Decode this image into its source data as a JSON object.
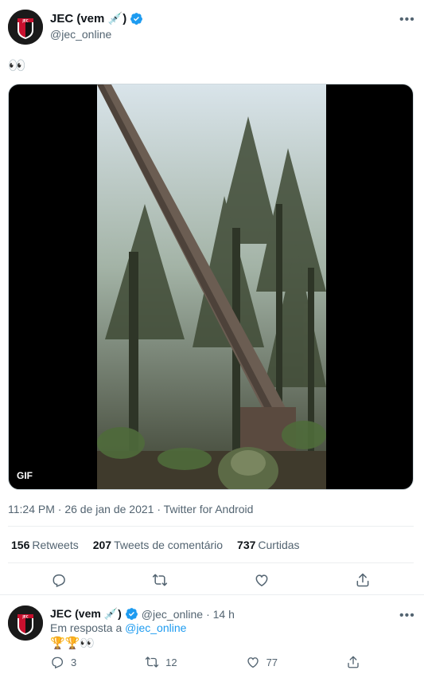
{
  "tweet": {
    "display_name": "JEC (vem 💉)",
    "handle": "@jec_online",
    "text": "👀",
    "media_badge": "GIF",
    "timestamp": "11:24 PM · 26 de jan de 2021 · Twitter for Android",
    "stats": {
      "retweets_count": "156",
      "retweets_label": "Retweets",
      "comments_count": "207",
      "comments_label": "Tweets de comentário",
      "likes_count": "737",
      "likes_label": "Curtidas"
    },
    "more_icon": "more-icon",
    "action_icons": [
      "reply-icon",
      "retweet-icon",
      "like-icon",
      "share-icon"
    ]
  },
  "reply": {
    "display_name": "JEC (vem 💉)",
    "handle": "@jec_online",
    "time": "· 14 h",
    "reply_prefix": "Em resposta a ",
    "reply_to": "@jec_online",
    "text": "🏆🏆👀",
    "counts": {
      "replies": "3",
      "retweets": "12",
      "likes": "77"
    }
  },
  "colors": {
    "text": "#0f1419",
    "secondary": "#536471",
    "link": "#1d9bf0",
    "verified": "#1d9bf0",
    "divider": "#ebeef0"
  }
}
